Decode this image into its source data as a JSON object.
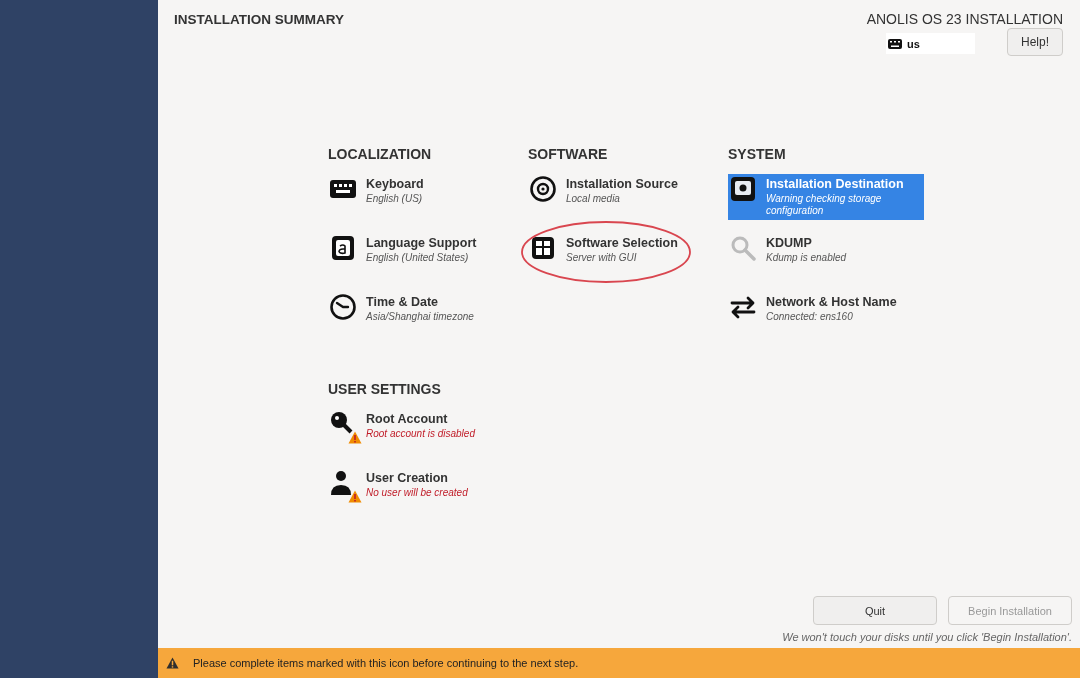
{
  "header": {
    "title": "INSTALLATION SUMMARY",
    "product": "ANOLIS OS 23 INSTALLATION",
    "layout": "us",
    "help": "Help!"
  },
  "sections": [
    {
      "title": "LOCALIZATION",
      "items": [
        {
          "kind": "keyboard",
          "title": "Keyboard",
          "status": "English (US)",
          "selected": false,
          "warning": false,
          "circled": false
        },
        {
          "kind": "language",
          "title": "Language Support",
          "status": "English (United States)",
          "selected": false,
          "warning": false,
          "circled": false
        },
        {
          "kind": "clock",
          "title": "Time & Date",
          "status": "Asia/Shanghai timezone",
          "selected": false,
          "warning": false,
          "circled": false
        }
      ]
    },
    {
      "title": "SOFTWARE",
      "items": [
        {
          "kind": "disc",
          "title": "Installation Source",
          "status": "Local media",
          "selected": false,
          "warning": false,
          "circled": false
        },
        {
          "kind": "package",
          "title": "Software Selection",
          "status": "Server with GUI",
          "selected": false,
          "warning": false,
          "circled": true
        }
      ]
    },
    {
      "title": "SYSTEM",
      "items": [
        {
          "kind": "disk",
          "title": "Installation Destination",
          "status": "Warning checking storage configuration",
          "selected": true,
          "warning": false,
          "circled": false
        },
        {
          "kind": "search",
          "title": "KDUMP",
          "status": "Kdump is enabled",
          "selected": false,
          "warning": false,
          "circled": false
        },
        {
          "kind": "network",
          "title": "Network & Host Name",
          "status": "Connected: ens160",
          "selected": false,
          "warning": false,
          "circled": false
        }
      ]
    },
    {
      "title": "USER SETTINGS",
      "items": [
        {
          "kind": "key",
          "title": "Root Account",
          "status": "Root account is disabled",
          "selected": false,
          "warning": true,
          "circled": false
        },
        {
          "kind": "user",
          "title": "User Creation",
          "status": "No user will be created",
          "selected": false,
          "warning": true,
          "circled": false
        }
      ]
    }
  ],
  "buttons": [
    {
      "label": "Quit",
      "disabled": false
    },
    {
      "label": "Begin Installation",
      "disabled": true
    }
  ],
  "note": "We won't touch your disks until you click 'Begin Installation'.",
  "warning_bar": "Please complete items marked with this icon before continuing to the next step."
}
